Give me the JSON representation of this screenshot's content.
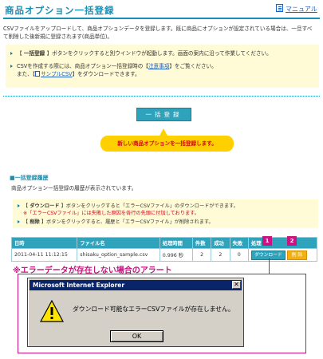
{
  "header": {
    "title": "商品オプション一括登録",
    "manual_label": "マニュアル"
  },
  "intro": {
    "line1": "CSVファイルをアップロードして、商品オプションデータを登録します。既に商品にオプションが設定されている場合は、一旦すべ",
    "line2": "て削除した後新規に登録されます(商品単位)。"
  },
  "notice": {
    "item1_prefix": "【",
    "item1_bold": " 一括登録 ",
    "item1_suffix": "】ボタンをクリックすると別ウインドウが起動します。画面の案内に沿って作業してください。",
    "item2_prefix": "CSVを作成する際には、商品オプション一括登録時の【",
    "item2_link": "注意事項",
    "item2_suffix": "】をご覧ください。",
    "item3_prefix": "また、【",
    "item3_link": "サンプルCSV",
    "item3_suffix": "】をダウンロードできます。"
  },
  "bulk_button_label": "一括登録",
  "callout_text": "新しい商品オプションを一括登録します。",
  "history": {
    "heading": "■一括登録履歴",
    "description": "商品オプション一括登録の履歴が表示されています。",
    "note1_prefix": "【",
    "note1_bold": " ダウンロード ",
    "note1_suffix": "】ボタンをクリックすると「エラーCSVファイル」のダウンロードができます。",
    "note1_sub": "※「エラーCSVファイル」には失敗した原因を各行の先頭に付加しております。",
    "note2_prefix": "【",
    "note2_bold": " 削除 ",
    "note2_suffix": "】ボタンをクリックすると、履歴と「エラーCSVファイル」が削除されます。"
  },
  "table": {
    "headers": [
      "日時",
      "ファイル名",
      "処理時間",
      "件数",
      "成功",
      "失敗",
      "処理"
    ],
    "row": {
      "datetime": "2011-04-11 11:12:15",
      "filename": "shisaku_option_sample.csv",
      "duration": "0.996 秒",
      "count": "2",
      "success": "2",
      "failure": "0",
      "download_label": "ダウンロード",
      "delete_label": "削 除"
    }
  },
  "badges": [
    "1",
    "2"
  ],
  "alert_heading": "※エラーデータが存在しない場合のアラート",
  "dialog": {
    "title": "Microsoft Internet Explorer",
    "close_glyph": "✕",
    "message": "ダウンロード可能なエラーCSVファイルが存在しません。",
    "ok_label": "OK"
  }
}
